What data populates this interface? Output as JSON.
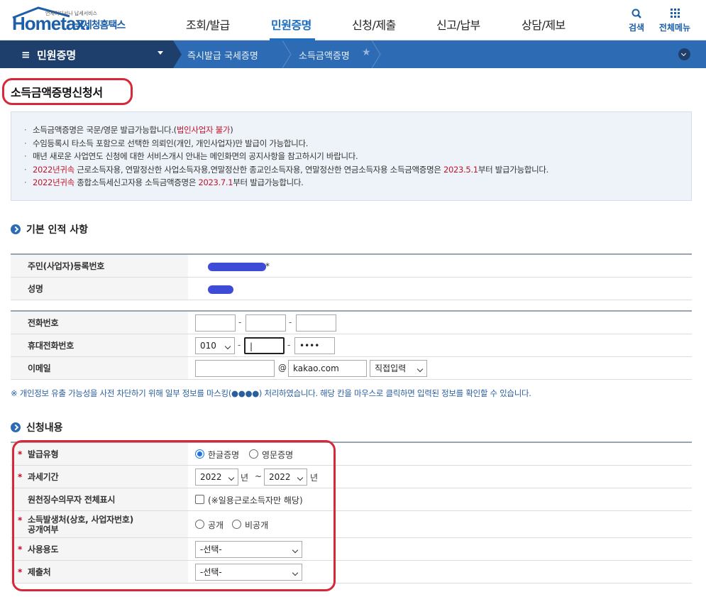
{
  "header": {
    "logo_small": "언제어디서나 납세서비스",
    "logo_word": "Hometax.",
    "logo_kr": "국세청홈택스",
    "menu": [
      {
        "label": "조회/발급"
      },
      {
        "label": "민원증명"
      },
      {
        "label": "신청/제출"
      },
      {
        "label": "신고/납부"
      },
      {
        "label": "상담/제보"
      }
    ],
    "search_label": "검색",
    "all_menu_label": "전체메뉴"
  },
  "navbar": {
    "menu_label": "민원증명",
    "breadcrumb": [
      "즉시발급 국세증명",
      "소득금액증명"
    ]
  },
  "page": {
    "title": "소득금액증명신청서"
  },
  "info": {
    "l1_a": "소득금액증명은 국문/영문 발급가능합니다.(",
    "l1_red": "법인사업자 불가",
    "l1_b": ")",
    "l2": "수임등록시 타소득 포함으로 선택한 의뢰인(개인, 개인사업자)만 발급이 가능합니다.",
    "l3": "매년 새로운 사업연도 신청에 대한 서비스개시 안내는 메인화면의 공지사항을 참고하시기 바랍니다.",
    "l4_red": "2022년귀속",
    "l4_a": " 근로소득자용, 연말정산한 사업소득자용,연말정산한 종교인소득자용, 연말정산한 연금소득자용 소득금액증명은 ",
    "l4_red2": "2023.5.1",
    "l4_b": "부터 발급가능합니다.",
    "l5_red": "2022년귀속",
    "l5_a": " 종합소득세신고자용 소득금액증명은 ",
    "l5_red2": "2023.7.1",
    "l5_b": "부터 발급가능합니다."
  },
  "basic": {
    "heading": "기본 인적 사항",
    "rrn_label": "주민(사업자)등록번호",
    "rrn_suffix": "*",
    "name_label": "성명"
  },
  "contact": {
    "phone_label": "전화번호",
    "phone": [
      "",
      "",
      ""
    ],
    "mobile_label": "휴대전화번호",
    "mobile_prefix": "010",
    "mobile_mid": "|",
    "mobile_last": "••••",
    "email_label": "이메일",
    "email_id": "",
    "email_at": "@",
    "email_domain": "kakao.com",
    "email_select": "직접입력",
    "dash": "-"
  },
  "notice": "※ 개인정보 유출 가능성을 사전 차단하기 위해 일부 정보를 마스킹(●●●●) 처리하였습니다. 해당 칸을 마우스로 클릭하면 입력된 정보를 확인할 수 있습니다.",
  "apply": {
    "heading": "신청내용",
    "req_mark": "*",
    "type_label": "발급유형",
    "type_options": [
      "한글증명",
      "영문증명"
    ],
    "period_label": "과세기간",
    "period_from": "2022",
    "period_to": "2022",
    "year_unit": "년",
    "tilde": "~",
    "withholder_label": "원천징수의무자 전체표시",
    "withholder_note": "(※일용근로소득자만 해당)",
    "source_label_1": "소득발생처(상호, 사업자번호)",
    "source_label_2": "공개여부",
    "source_options": [
      "공개",
      "비공개"
    ],
    "usage_label": "사용용도",
    "usage_value": "-선택-",
    "submit_label": "제출처",
    "submit_value": "-선택-"
  },
  "colors": {
    "brand": "#1d5fa8",
    "nav": "#2d6cb4",
    "nav_dark": "#1e3f6b",
    "annotation": "#d62839",
    "mask": "#3e4bd6"
  }
}
